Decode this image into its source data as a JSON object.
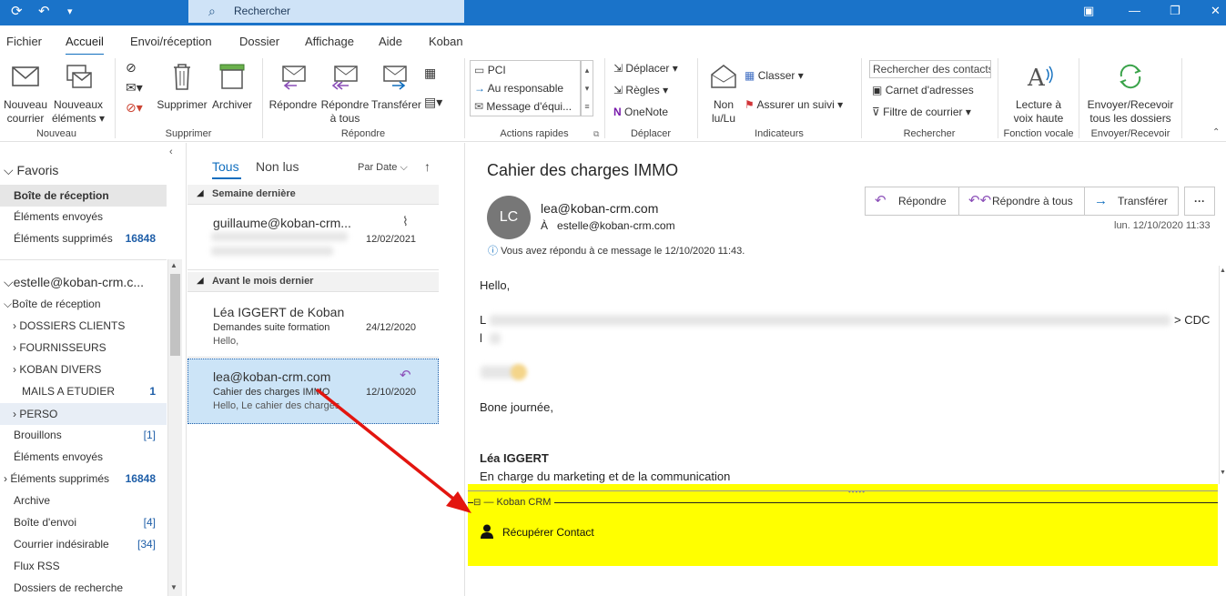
{
  "titlebar": {
    "search_placeholder": "Rechercher"
  },
  "menu": {
    "tabs": [
      "Fichier",
      "Accueil",
      "Envoi/réception",
      "Dossier",
      "Affichage",
      "Aide",
      "Koban"
    ]
  },
  "ribbon": {
    "new_mail": [
      "Nouveau",
      "courrier"
    ],
    "new_items": [
      "Nouveaux",
      "éléments ▾"
    ],
    "delete": "Supprimer",
    "archive": "Archiver",
    "reply": "Répondre",
    "reply_all": [
      "Répondre",
      "à tous"
    ],
    "forward": "Transférer",
    "quick": [
      "PCI",
      "Au responsable",
      "Message d'équi..."
    ],
    "move": "Déplacer ▾",
    "rules": "Règles ▾",
    "onenote": "OneNote",
    "unread": [
      "Non",
      "lu/Lu"
    ],
    "classify": "Classer ▾",
    "followup": "Assurer un suivi ▾",
    "search_contacts": "Rechercher des contacts",
    "address_book": "Carnet d'adresses",
    "filter_mail": "Filtre de courrier ▾",
    "read_aloud": [
      "Lecture à",
      "voix haute"
    ],
    "send_receive": [
      "Envoyer/Recevoir",
      "tous les dossiers"
    ],
    "groups": [
      "Nouveau",
      "Supprimer",
      "Répondre",
      "Actions rapides",
      "Déplacer",
      "Indicateurs",
      "Rechercher",
      "Fonction vocale",
      "Envoyer/Recevoir"
    ]
  },
  "sidebar": {
    "favorites": "Favoris",
    "fav_items": [
      {
        "label": "Boîte de réception",
        "count": ""
      },
      {
        "label": "Éléments envoyés",
        "count": ""
      },
      {
        "label": "Éléments supprimés",
        "count": "16848"
      }
    ],
    "account": "estelle@koban-crm.c...",
    "folders": [
      {
        "label": "Boîte de réception",
        "count": ""
      },
      {
        "label": "DOSSIERS CLIENTS",
        "count": ""
      },
      {
        "label": "FOURNISSEURS",
        "count": ""
      },
      {
        "label": "KOBAN DIVERS",
        "count": ""
      },
      {
        "label": "MAILS A ETUDIER",
        "count": "1"
      },
      {
        "label": "PERSO",
        "count": ""
      },
      {
        "label": "Brouillons",
        "count": "[1]"
      },
      {
        "label": "Éléments envoyés",
        "count": ""
      },
      {
        "label": "Éléments supprimés",
        "count": "16848"
      },
      {
        "label": "Archive",
        "count": ""
      },
      {
        "label": "Boîte d'envoi",
        "count": "[4]"
      },
      {
        "label": "Courrier indésirable",
        "count": "[34]"
      },
      {
        "label": "Flux RSS",
        "count": ""
      },
      {
        "label": "Dossiers de recherche",
        "count": ""
      }
    ]
  },
  "list": {
    "tabs": [
      "Tous",
      "Non lus"
    ],
    "sort": "Par Date",
    "groups": [
      "Semaine dernière",
      "Avant le mois dernier"
    ],
    "items": [
      {
        "from": "guillaume@koban-crm...",
        "subject": "",
        "preview": "",
        "date": "12/02/2021"
      },
      {
        "from": "Léa IGGERT de Koban",
        "subject": "Demandes suite formation",
        "preview": "Hello,",
        "date": "24/12/2020"
      },
      {
        "from": "lea@koban-crm.com",
        "subject": "Cahier des charges IMMO",
        "preview": "Hello,   Le cahier des charges",
        "date": "12/10/2020"
      }
    ]
  },
  "reading": {
    "subject": "Cahier des charges IMMO",
    "avatar": "LC",
    "from": "lea@koban-crm.com",
    "to_label": "À",
    "to": "estelle@koban-crm.com",
    "date": "lun. 12/10/2020 11:33",
    "replied_note": "Vous avez répondu à ce message le 12/10/2020 11:43.",
    "buttons": [
      "Répondre",
      "Répondre à tous",
      "Transférer"
    ],
    "body": {
      "greeting": "Hello,",
      "cdc_fragment": "> CDC",
      "closing": "Bone journée,",
      "sig_name": "Léa IGGERT",
      "sig_role": "En charge du marketing et de la communication"
    }
  },
  "koban": {
    "title": "Koban CRM",
    "action": "Récupérer Contact"
  },
  "colors": {
    "accent": "#106ebe",
    "titlebar": "#1a73c9",
    "selected": "#cce4f7",
    "highlight": "#ffff00"
  }
}
